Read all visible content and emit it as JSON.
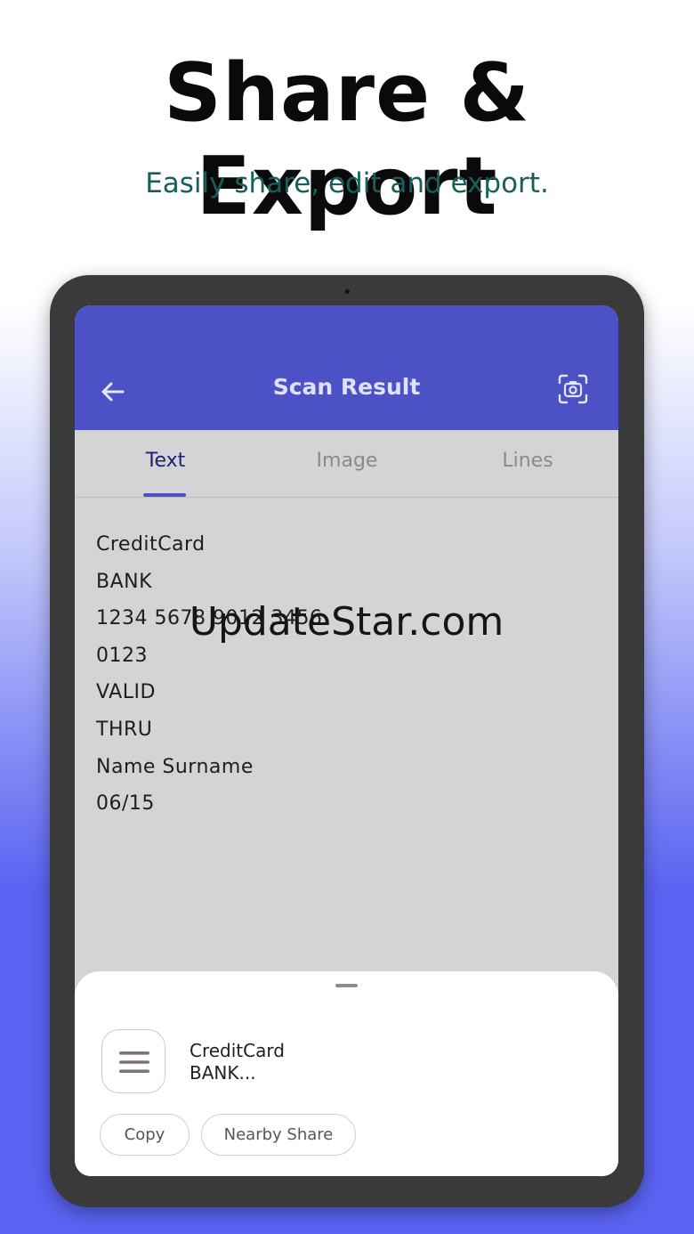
{
  "headline": "Share & Export",
  "subheadline": "Easily share, edit and export.",
  "app": {
    "title": "Scan Result",
    "back_icon": "arrow-left-icon",
    "action_icon": "camera-scan-icon",
    "tabs": [
      {
        "label": "Text",
        "active": true
      },
      {
        "label": "Image",
        "active": false
      },
      {
        "label": "Lines",
        "active": false
      }
    ],
    "result_lines": [
      "CreditCard",
      "BANK",
      "1234 5678 9012 3456",
      "0123",
      "VALID",
      "THRU",
      "Name Surname",
      "06/15"
    ]
  },
  "watermark": "UpdateStar.com",
  "share_sheet": {
    "preview_icon": "text-lines-icon",
    "preview_line_1": "CreditCard",
    "preview_line_2": "BANK...",
    "actions": [
      "Copy",
      "Nearby Share"
    ]
  },
  "colors": {
    "appbar": "#4c51c6",
    "tab_active": "#1c2275",
    "subheadline": "#17605a",
    "background_bottom": "#5a63f2"
  }
}
